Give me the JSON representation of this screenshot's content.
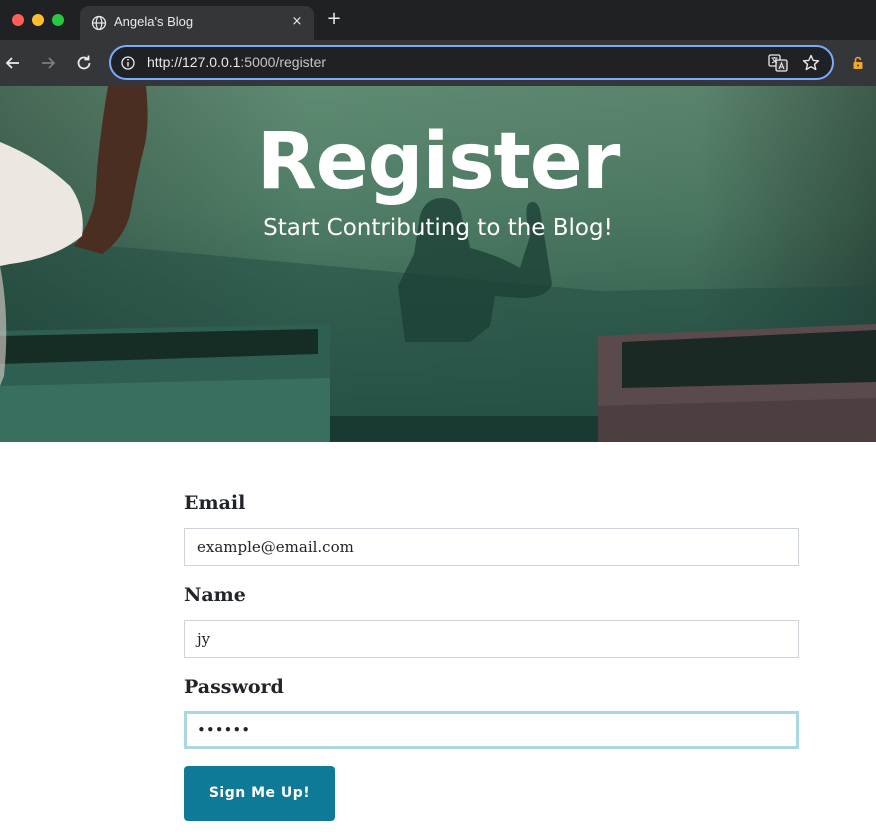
{
  "browser": {
    "tab_title": "Angela's Blog",
    "tab_close": "×",
    "new_tab": "+",
    "url_host": "http://127.0.0.1",
    "url_rest": ":5000/register",
    "icons": [
      "back-arrow-icon",
      "forward-arrow-icon",
      "reload-icon",
      "info-icon",
      "globe-icon",
      "translate-icon",
      "star-icon",
      "lock-icon"
    ]
  },
  "hero": {
    "title": "Register",
    "subtitle": "Start Contributing to the Blog!"
  },
  "form": {
    "email": {
      "label": "Email",
      "value": "example@email.com"
    },
    "name": {
      "label": "Name",
      "value": "jy"
    },
    "password": {
      "label": "Password",
      "value": "••••••"
    },
    "submit_label": "Sign Me Up!"
  },
  "colors": {
    "accent": "#0f7a98",
    "focus_ring": "#a9d8e2",
    "omnibox_focus": "#7cacf8"
  }
}
